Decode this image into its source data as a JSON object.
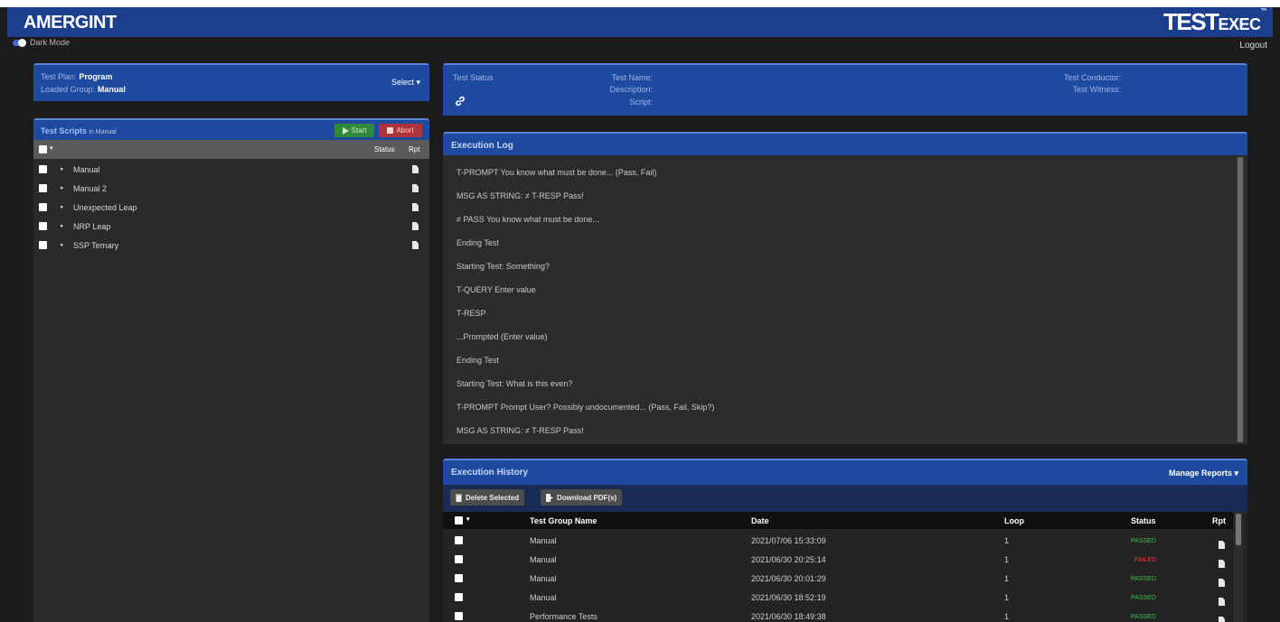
{
  "header": {
    "brand_left": "AMERGINT",
    "brand_right_big": "TEST",
    "brand_right_small": "EXEC",
    "trademark": "™",
    "dark_mode_label": "Dark Mode",
    "logout_label": "Logout"
  },
  "plan": {
    "test_plan_label": "Test Plan:",
    "test_plan_value": "Program",
    "loaded_group_label": "Loaded Group:",
    "loaded_group_value": "Manual",
    "select_label": "Select ▾"
  },
  "scripts": {
    "title": "Test Scripts",
    "subtitle": "in Manual",
    "start_label": "Start",
    "abort_label": "Abort",
    "col_status": "Status",
    "col_rpt": "Rpt",
    "items": [
      {
        "name": "Manual"
      },
      {
        "name": "Manual 2"
      },
      {
        "name": "Unexpected Leap"
      },
      {
        "name": "NRP Leap"
      },
      {
        "name": "SSP Ternary"
      }
    ]
  },
  "status": {
    "title": "Test Status",
    "test_name_label": "Test Name:",
    "description_label": "Description:",
    "script_label": "Script:",
    "conductor_label": "Test Conductor:",
    "witness_label": "Test Witness:"
  },
  "log": {
    "title": "Execution Log",
    "lines": [
      "T-PROMPT You know what must be done... (Pass, Fail)",
      "MSG AS STRING: ≠ T-RESP Pass!",
      "≠ PASS You know what must be done...",
      "Ending Test",
      "Starting Test: Something?",
      "T-QUERY Enter value",
      "T-RESP",
      "...Prompted (Enter value)",
      "Ending Test",
      "Starting Test: What is this even?",
      "T-PROMPT Prompt User? Possibly undocumented... (Pass, Fail, Skip?)",
      "MSG AS STRING: ≠ T-RESP Pass!"
    ]
  },
  "history": {
    "title": "Execution History",
    "manage_reports": "Manage Reports ▾",
    "delete_selected": "Delete Selected",
    "download_pdf": "Download PDF(s)",
    "columns": {
      "group": "Test Group Name",
      "date": "Date",
      "loop": "Loop",
      "status": "Status",
      "rpt": "Rpt"
    },
    "rows": [
      {
        "group": "Manual",
        "date": "2021/07/06 15:33:09",
        "loop": "1",
        "status": "PASSED"
      },
      {
        "group": "Manual",
        "date": "2021/06/30 20:25:14",
        "loop": "1",
        "status": "FAILED"
      },
      {
        "group": "Manual",
        "date": "2021/06/30 20:01:29",
        "loop": "1",
        "status": "PASSED"
      },
      {
        "group": "Manual",
        "date": "2021/06/30 18:52:19",
        "loop": "1",
        "status": "PASSED"
      },
      {
        "group": "Performance Tests",
        "date": "2021/06/30 18:49:38",
        "loop": "1",
        "status": "PASSED"
      }
    ]
  },
  "colors": {
    "header_blue": "#1b3f8d",
    "panel_blue": "#1e4aa0",
    "passed": "#3fbf4b",
    "failed": "#d94040",
    "start_green": "#2e8b3a",
    "abort_red": "#b0323a"
  },
  "icons": [
    "link-icon",
    "play-icon",
    "stop-icon",
    "document-icon",
    "trash-icon",
    "download-icon",
    "caret-right-icon",
    "caret-down-icon"
  ]
}
